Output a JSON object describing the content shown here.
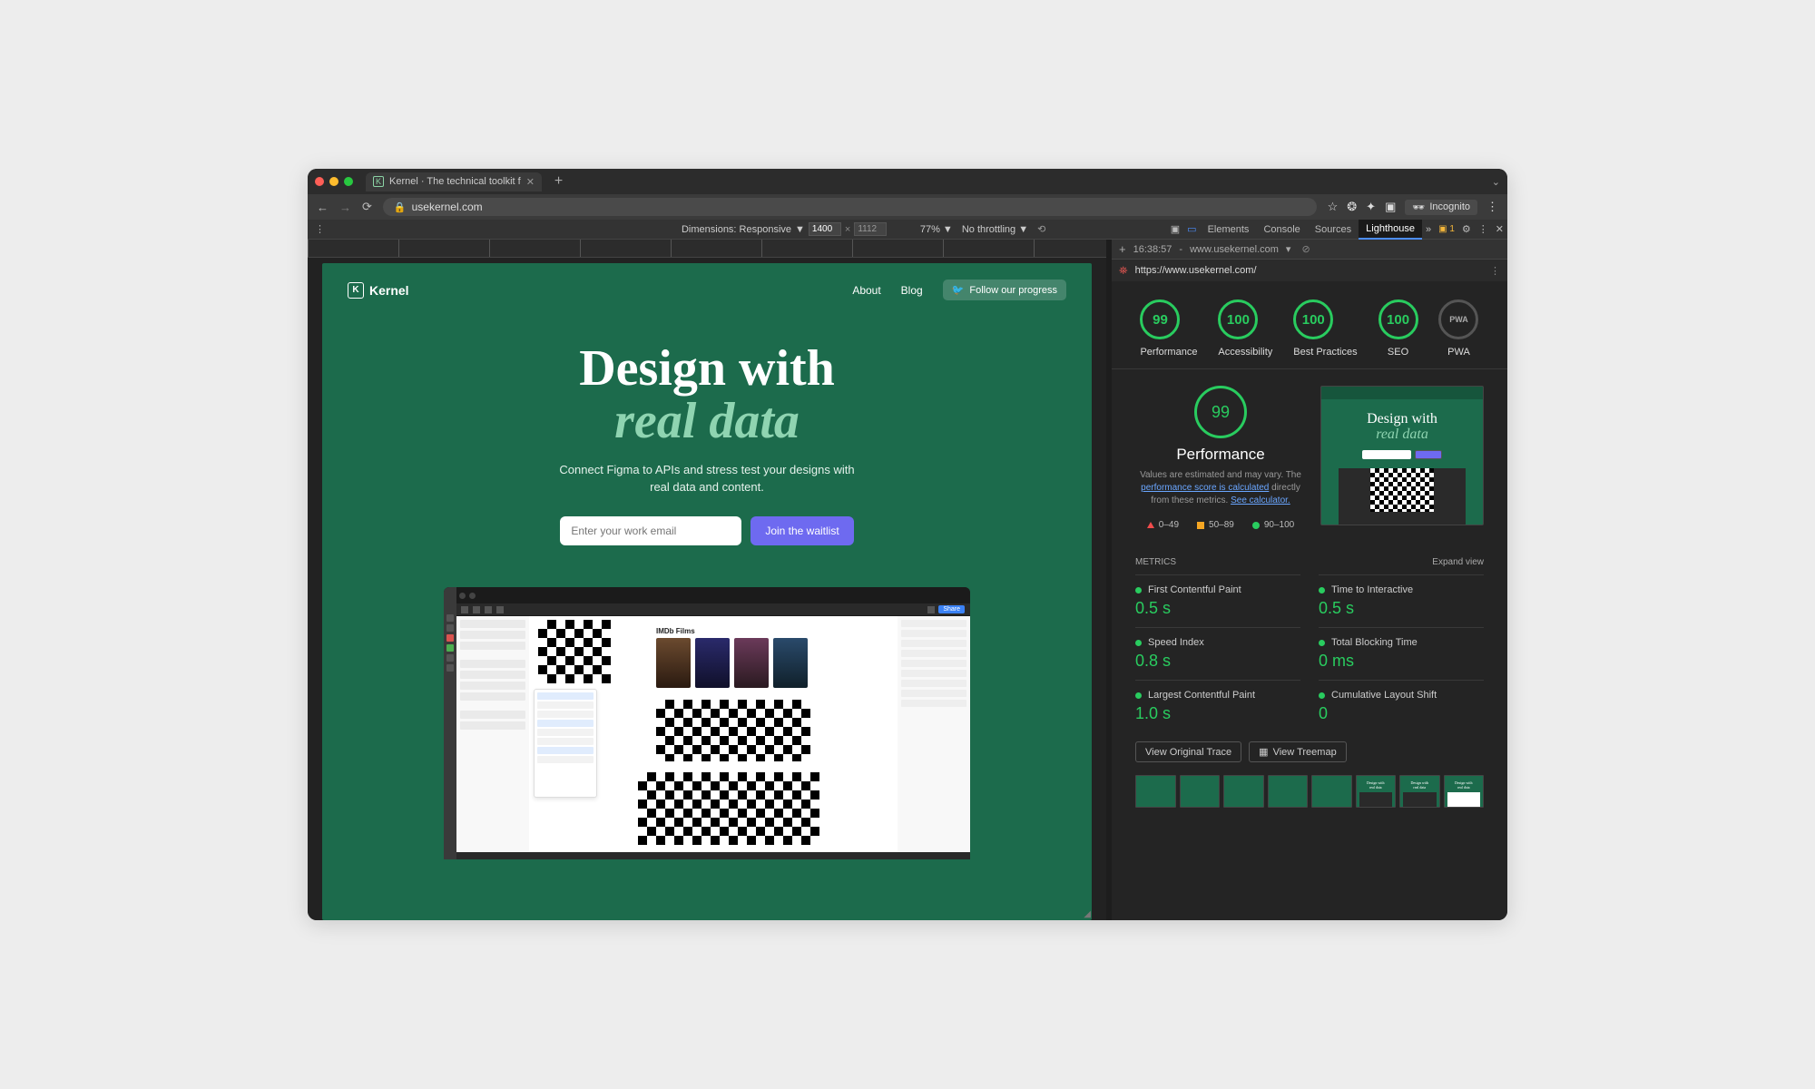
{
  "colors": {
    "red": "#ff5f57",
    "yellow": "#febc2e",
    "green_dot": "#28c840"
  },
  "tab": {
    "title": "Kernel · The technical toolkit f"
  },
  "addressbar": {
    "url": "usekernel.com"
  },
  "incognito": "Incognito",
  "device_toolbar": {
    "dimensions_label": "Dimensions: Responsive",
    "w": "1400",
    "h": "1112",
    "zoom": "77%",
    "throttle": "No throttling"
  },
  "devtools_tabs": [
    "Elements",
    "Console",
    "Sources",
    "Lighthouse"
  ],
  "devtools_active": "Lighthouse",
  "warn_count": "1",
  "lighthouse_tab": {
    "time": "16:38:57",
    "host": "www.usekernel.com"
  },
  "lighthouse_url": "https://www.usekernel.com/",
  "page": {
    "brand": "Kernel",
    "nav": {
      "about": "About",
      "blog": "Blog",
      "follow": "Follow our progress"
    },
    "hero_line1": "Design with",
    "hero_line2": "real data",
    "subtitle1": "Connect Figma to APIs and stress test your designs with",
    "subtitle2": "real data and content.",
    "email_placeholder": "Enter your work email",
    "cta": "Join the waitlist",
    "figma_label": "IMDb Films"
  },
  "scores": [
    {
      "label": "Performance",
      "value": "99"
    },
    {
      "label": "Accessibility",
      "value": "100"
    },
    {
      "label": "Best Practices",
      "value": "100"
    },
    {
      "label": "SEO",
      "value": "100"
    },
    {
      "label": "PWA",
      "value": "PWA"
    }
  ],
  "perf": {
    "big": "99",
    "title": "Performance",
    "note_a": "Values are estimated and may vary. The",
    "note_link1": "performance score is calculated",
    "note_b": " directly from these metrics. ",
    "note_link2": "See calculator.",
    "legend": {
      "l1": "0–49",
      "l2": "50–89",
      "l3": "90–100"
    }
  },
  "metrics_header": {
    "title": "METRICS",
    "expand": "Expand view"
  },
  "metrics": [
    {
      "name": "First Contentful Paint",
      "value": "0.5 s"
    },
    {
      "name": "Time to Interactive",
      "value": "0.5 s"
    },
    {
      "name": "Speed Index",
      "value": "0.8 s"
    },
    {
      "name": "Total Blocking Time",
      "value": "0 ms"
    },
    {
      "name": "Largest Contentful Paint",
      "value": "1.0 s"
    },
    {
      "name": "Cumulative Layout Shift",
      "value": "0"
    }
  ],
  "trace_buttons": {
    "orig": "View Original Trace",
    "treemap": "View Treemap"
  }
}
